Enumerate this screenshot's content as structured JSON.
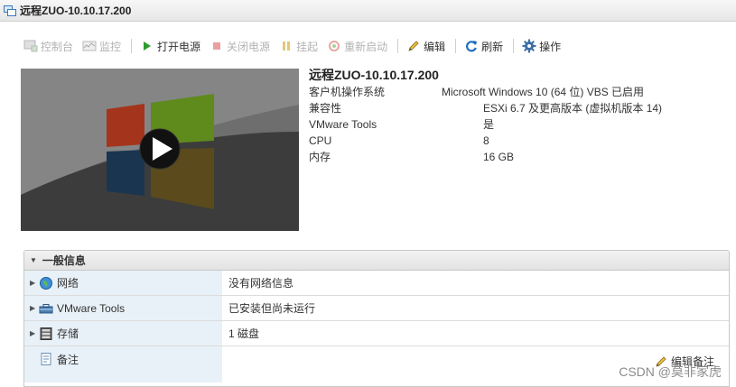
{
  "window": {
    "title": "远程ZUO-10.10.17.200"
  },
  "toolbar": {
    "console": "控制台",
    "monitor": "监控",
    "power_on": "打开电源",
    "power_off": "关闭电源",
    "suspend": "挂起",
    "restart": "重新启动",
    "edit": "编辑",
    "refresh": "刷新",
    "actions": "操作"
  },
  "summary": {
    "vm_name": "远程ZUO-10.10.17.200",
    "rows": [
      {
        "label": "客户机操作系统",
        "value": "Microsoft Windows 10 (64 位) VBS 已启用"
      },
      {
        "label": "兼容性",
        "value": "ESXi 6.7 及更高版本 (虚拟机版本 14)"
      },
      {
        "label": "VMware Tools",
        "value": "是"
      },
      {
        "label": "CPU",
        "value": "8"
      },
      {
        "label": "内存",
        "value": "16 GB"
      }
    ]
  },
  "general": {
    "header": "一般信息",
    "rows": [
      {
        "label": "网络",
        "value": "没有网络信息"
      },
      {
        "label": "VMware Tools",
        "value": "已安装但尚未运行"
      },
      {
        "label": "存储",
        "value": "1 磁盘"
      },
      {
        "label": "备注",
        "value": ""
      }
    ],
    "edit_notes": "编辑备注"
  },
  "watermark": "CSDN @莫非家虎",
  "colors": {
    "accent_green": "#2e9b2e",
    "label_bg": "#e8f1f8",
    "disabled": "#b3b3b3"
  }
}
